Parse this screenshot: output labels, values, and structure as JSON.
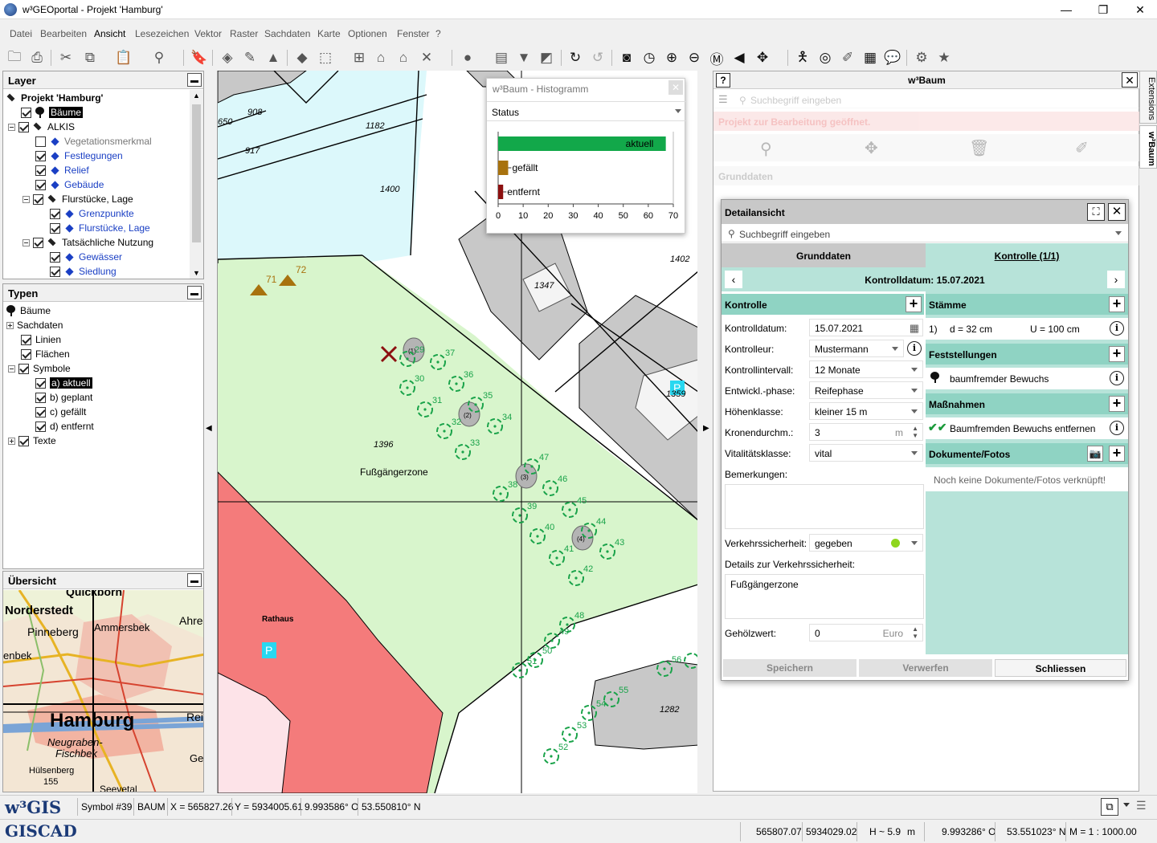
{
  "window": {
    "title": "w³GEOportal - Projekt 'Hamburg'"
  },
  "menu": [
    "Datei",
    "Bearbeiten",
    "Ansicht",
    "Lesezeichen",
    "Vektor",
    "Raster",
    "Sachdaten",
    "Karte",
    "Optionen",
    "Fenster",
    "?"
  ],
  "layer_panel": {
    "title": "Layer",
    "items": [
      "Projekt 'Hamburg'",
      "Bäume",
      "ALKIS",
      "Vegetationsmerkmal",
      "Festlegungen",
      "Relief",
      "Gebäude",
      "Flurstücke, Lage",
      "Grenzpunkte",
      "Flurstücke, Lage",
      "Tatsächliche Nutzung",
      "Gewässer",
      "Siedlung"
    ]
  },
  "types_panel": {
    "title": "Typen",
    "items": [
      "Bäume",
      "Sachdaten",
      "Linien",
      "Flächen",
      "Symbole",
      "a) aktuell",
      "b) geplant",
      "c) gefällt",
      "d) entfernt",
      "Texte"
    ]
  },
  "overview_panel": {
    "title": "Übersicht",
    "places": [
      "Quickborn",
      "Norderstedt",
      "Ammersbek",
      "Ahre",
      "Pinneberg",
      "enbek",
      "Hamburg",
      "Rei",
      "Neugraben-",
      "Fischbek",
      "Ge",
      "Hülsenberg",
      "155",
      "Seevetal"
    ]
  },
  "map": {
    "parcels": [
      "908",
      "650",
      "1182",
      "917",
      "1400",
      "1402",
      "1347",
      "1359",
      "1396",
      "1282"
    ],
    "zone_label": "Fußgängerzone",
    "townhall_label": "Rathaus",
    "parking": "P",
    "trees": [
      {
        "n": "29"
      },
      {
        "n": "30"
      },
      {
        "n": "31"
      },
      {
        "n": "32"
      },
      {
        "n": "33"
      },
      {
        "n": "34"
      },
      {
        "n": "35"
      },
      {
        "n": "36"
      },
      {
        "n": "37"
      },
      {
        "n": "38"
      },
      {
        "n": "39"
      },
      {
        "n": "40"
      },
      {
        "n": "41"
      },
      {
        "n": "42"
      },
      {
        "n": "43"
      },
      {
        "n": "44"
      },
      {
        "n": "45"
      },
      {
        "n": "46"
      },
      {
        "n": "47"
      },
      {
        "n": "48"
      },
      {
        "n": "49"
      },
      {
        "n": "50"
      },
      {
        "n": "51"
      },
      {
        "n": "52"
      },
      {
        "n": "53"
      },
      {
        "n": "54"
      },
      {
        "n": "55"
      },
      {
        "n": "56"
      }
    ],
    "felled": [
      "71",
      "72"
    ],
    "group_labels": [
      "(1)",
      "(2)",
      "(3)",
      "(4)"
    ]
  },
  "histogram": {
    "title": "w³Baum - Histogramm",
    "field": "Status",
    "chart_data": {
      "type": "bar",
      "categories": [
        "aktuell",
        "gefällt",
        "entfernt"
      ],
      "values": [
        67,
        4,
        2
      ],
      "xlim": [
        0,
        70
      ],
      "xticks": [
        "0",
        "10",
        "20",
        "30",
        "40",
        "50",
        "60",
        "70"
      ],
      "colors": [
        "#12a84a",
        "#a8720e",
        "#8c1010"
      ]
    }
  },
  "dock": {
    "title": "w³Baum",
    "search_placeholder": "Suchbegriff eingeben",
    "banner": "Projekt zur Bearbeitung geöffnet.",
    "section": "Grunddaten",
    "tabs": [
      "Extensions",
      "w³Baum"
    ]
  },
  "detail": {
    "title": "Detailansicht",
    "search_placeholder": "Suchbegriff eingeben",
    "tab_basic": "Grunddaten",
    "tab_control": "Kontrolle (1/1)",
    "date_header": "Kontrolldatum: 15.07.2021",
    "control_head": "Kontrolle",
    "fields": [
      {
        "label": "Kontrolldatum:",
        "value": "15.07.2021"
      },
      {
        "label": "Kontrolleur:",
        "value": "Mustermann"
      },
      {
        "label": "Kontrollintervall:",
        "value": "12 Monate"
      },
      {
        "label": "Entwickl.-phase:",
        "value": "Reifephase"
      },
      {
        "label": "Höhenklasse:",
        "value": "kleiner 15 m"
      },
      {
        "label": "Kronendurchm.:",
        "value": "3",
        "unit": "m"
      },
      {
        "label": "Vitalitätsklasse:",
        "value": "vital"
      }
    ],
    "remarks_label": "Bemerkungen:",
    "traffic_label": "Verkehrssicherheit:",
    "traffic_value": "gegeben",
    "traffic_details_label": "Details zur Verkehrssicherheit:",
    "traffic_details_value": "Fußgängerzone",
    "wood_label": "Gehölzwert:",
    "wood_value": "0",
    "wood_unit": "Euro",
    "stems_head": "Stämme",
    "stem": {
      "idx": "1)",
      "d": "d = 32 cm",
      "u": "U = 100 cm"
    },
    "findings_head": "Feststellungen",
    "finding": "baumfremder Bewuchs",
    "measures_head": "Maßnahmen",
    "measure": "Baumfremden Bewuchs entfernen",
    "docs_head": "Dokumente/Fotos",
    "docs_empty": "Noch keine Dokumente/Fotos verknüpft!",
    "btn_save": "Speichern",
    "btn_discard": "Verwerfen",
    "btn_close": "Schliessen"
  },
  "statusbar": {
    "brand": "w³GIS",
    "brand2": "GISCAD",
    "symbol": "Symbol #39",
    "type": "BAUM",
    "x": "X = 565827.26",
    "y": "Y = 5934005.61",
    "lon": "9.993586° O",
    "lat": "53.550810° N",
    "c1": "565807.07",
    "c2": "5934029.02",
    "h": "H ~ 5.9",
    "hu": "m",
    "lon2": "9.993286° O",
    "lat2": "53.551023° N",
    "scale": "M = 1 : 1000.00"
  }
}
